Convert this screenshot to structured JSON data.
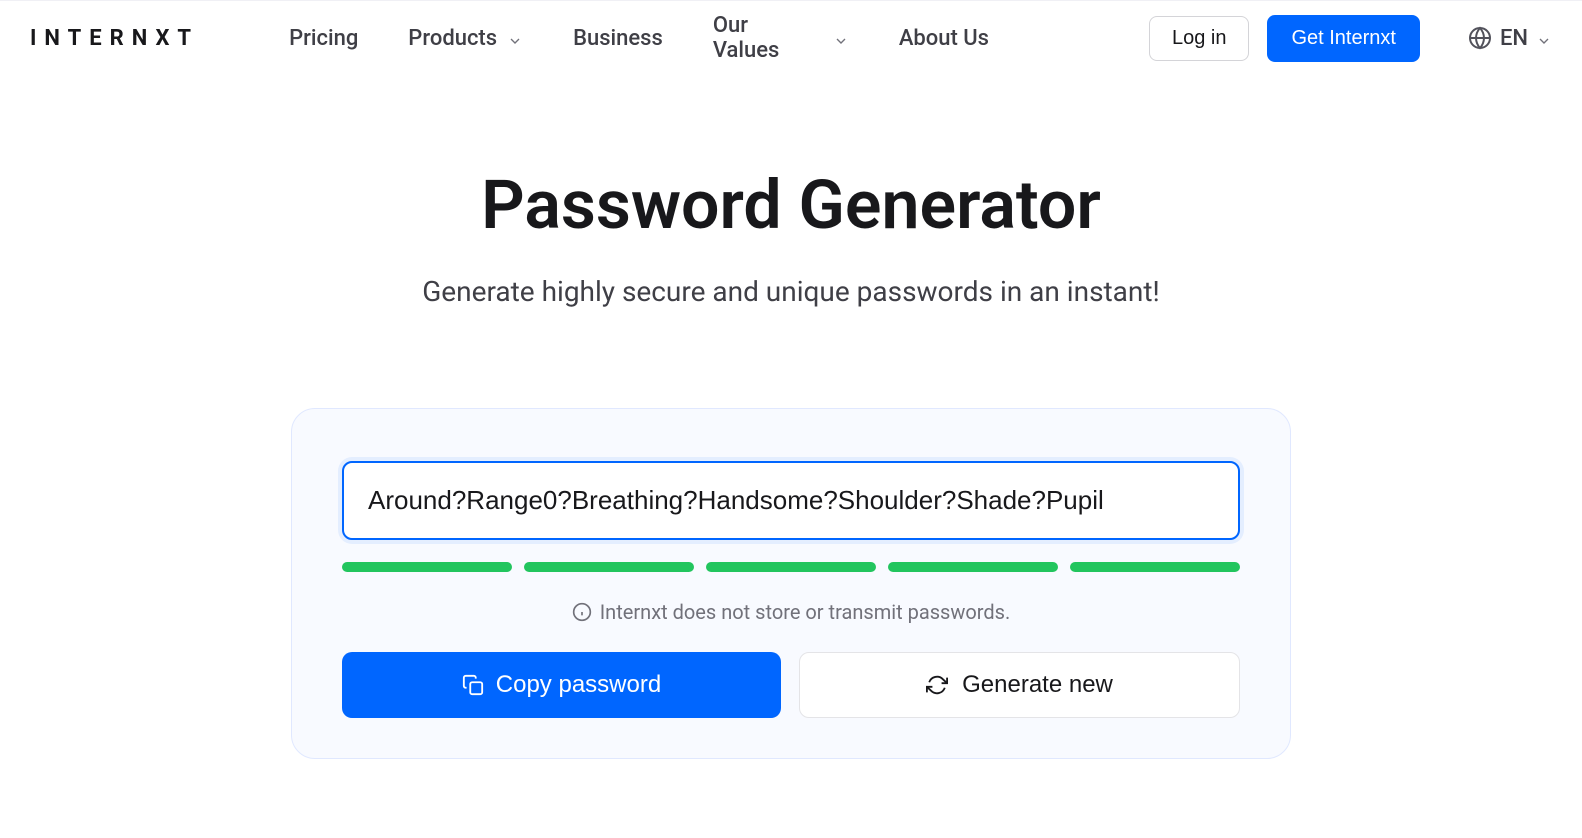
{
  "header": {
    "logo": "INTERNXT",
    "nav": {
      "pricing": "Pricing",
      "products": "Products",
      "business": "Business",
      "values": "Our Values",
      "about": "About Us"
    },
    "login": "Log in",
    "cta": "Get Internxt",
    "lang": "EN"
  },
  "main": {
    "title": "Password Generator",
    "subtitle": "Generate highly secure and unique passwords in an instant!"
  },
  "card": {
    "password": "Around?Range0?Breathing?Handsome?Shoulder?Shade?Pupil",
    "disclaimer": "Internxt does not store or transmit passwords.",
    "copy_label": "Copy password",
    "generate_label": "Generate new",
    "strength_segments": 5
  }
}
